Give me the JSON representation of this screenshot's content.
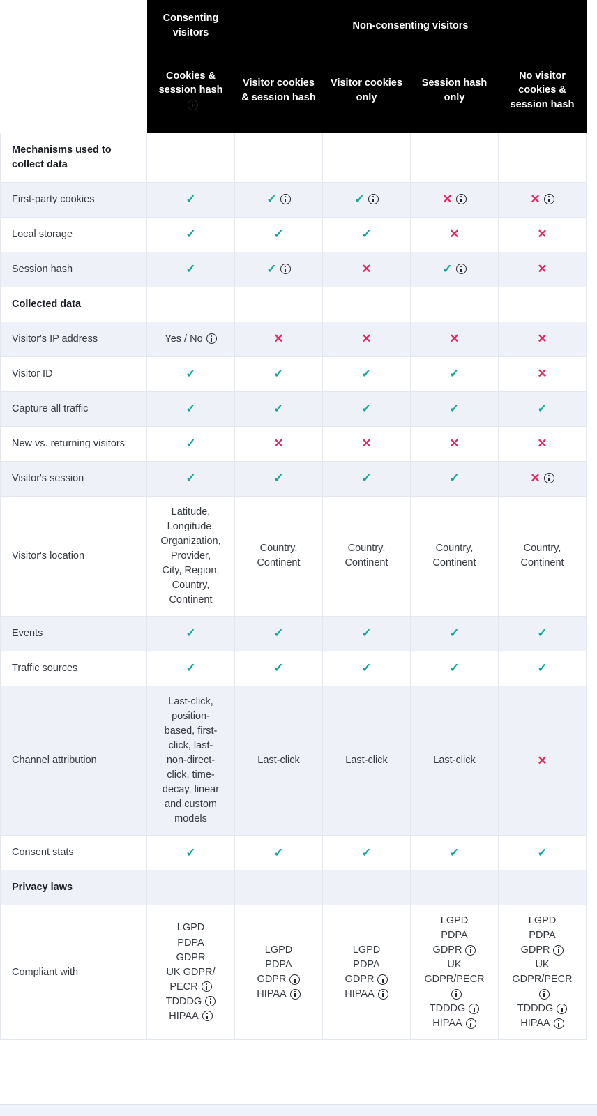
{
  "header": {
    "corner_blank": "",
    "groups": [
      {
        "label": "Consenting visitors",
        "span": 1
      },
      {
        "label": "Non-consenting visitors",
        "span": 4
      }
    ],
    "columns": [
      {
        "label": "Cookies & session hash",
        "info": true
      },
      {
        "label": "Visitor cookies & session hash",
        "info": false
      },
      {
        "label": "Visitor cookies only",
        "info": false
      },
      {
        "label": "Session hash only",
        "info": false
      },
      {
        "label": "No visitor cookies & session hash",
        "info": false
      }
    ]
  },
  "colors": {
    "check": "#0fa896",
    "cross": "#e1295f",
    "header_bg": "#000000",
    "shade_row": "#eef1f7",
    "border": "#e3e8ef",
    "text": "#343a40"
  },
  "rows": [
    {
      "feature": "Mechanisms used to collect data",
      "section": true,
      "shade": false,
      "cells": [
        {
          "type": "empty"
        },
        {
          "type": "empty"
        },
        {
          "type": "empty"
        },
        {
          "type": "empty"
        },
        {
          "type": "empty"
        }
      ]
    },
    {
      "feature": "First-party cookies",
      "section": false,
      "shade": true,
      "cells": [
        {
          "type": "check",
          "info": false
        },
        {
          "type": "check",
          "info": true
        },
        {
          "type": "check",
          "info": true
        },
        {
          "type": "cross",
          "info": true
        },
        {
          "type": "cross",
          "info": true
        }
      ]
    },
    {
      "feature": "Local storage",
      "section": false,
      "shade": false,
      "cells": [
        {
          "type": "check",
          "info": false
        },
        {
          "type": "check",
          "info": false
        },
        {
          "type": "check",
          "info": false
        },
        {
          "type": "cross",
          "info": false
        },
        {
          "type": "cross",
          "info": false
        }
      ]
    },
    {
      "feature": "Session hash",
      "section": false,
      "shade": true,
      "cells": [
        {
          "type": "check",
          "info": false
        },
        {
          "type": "check",
          "info": true
        },
        {
          "type": "cross",
          "info": false
        },
        {
          "type": "check",
          "info": true
        },
        {
          "type": "cross",
          "info": false
        }
      ]
    },
    {
      "feature": "Collected data",
      "section": true,
      "shade": false,
      "cells": [
        {
          "type": "empty"
        },
        {
          "type": "empty"
        },
        {
          "type": "empty"
        },
        {
          "type": "empty"
        },
        {
          "type": "empty"
        }
      ]
    },
    {
      "feature": "Visitor's IP address",
      "section": false,
      "shade": true,
      "cells": [
        {
          "type": "text",
          "text": "Yes / No",
          "info": true
        },
        {
          "type": "cross",
          "info": false
        },
        {
          "type": "cross",
          "info": false
        },
        {
          "type": "cross",
          "info": false
        },
        {
          "type": "cross",
          "info": false
        }
      ]
    },
    {
      "feature": "Visitor ID",
      "section": false,
      "shade": false,
      "cells": [
        {
          "type": "check",
          "info": false
        },
        {
          "type": "check",
          "info": false
        },
        {
          "type": "check",
          "info": false
        },
        {
          "type": "check",
          "info": false
        },
        {
          "type": "cross",
          "info": false
        }
      ]
    },
    {
      "feature": "Capture all traffic",
      "section": false,
      "shade": true,
      "cells": [
        {
          "type": "check",
          "info": false
        },
        {
          "type": "check",
          "info": false
        },
        {
          "type": "check",
          "info": false
        },
        {
          "type": "check",
          "info": false
        },
        {
          "type": "check",
          "info": false
        }
      ]
    },
    {
      "feature": "New vs. returning visitors",
      "section": false,
      "shade": false,
      "cells": [
        {
          "type": "check",
          "info": false
        },
        {
          "type": "cross",
          "info": false
        },
        {
          "type": "cross",
          "info": false
        },
        {
          "type": "cross",
          "info": false
        },
        {
          "type": "cross",
          "info": false
        }
      ]
    },
    {
      "feature": "Visitor's session",
      "section": false,
      "shade": true,
      "cells": [
        {
          "type": "check",
          "info": false
        },
        {
          "type": "check",
          "info": false
        },
        {
          "type": "check",
          "info": false
        },
        {
          "type": "check",
          "info": false
        },
        {
          "type": "cross",
          "info": true
        }
      ]
    },
    {
      "feature": "Visitor's location",
      "section": false,
      "shade": false,
      "cells": [
        {
          "type": "lines",
          "lines": [
            "Latitude,",
            "Longitude,",
            "Organization,",
            "Provider,",
            "City, Region,",
            "Country,",
            "Continent"
          ],
          "info": false
        },
        {
          "type": "lines",
          "lines": [
            "Country,",
            "Continent"
          ],
          "info": false
        },
        {
          "type": "lines",
          "lines": [
            "Country,",
            "Continent"
          ],
          "info": false
        },
        {
          "type": "lines",
          "lines": [
            "Country,",
            "Continent"
          ],
          "info": false
        },
        {
          "type": "lines",
          "lines": [
            "Country,",
            "Continent"
          ],
          "info": false
        }
      ]
    },
    {
      "feature": "Events",
      "section": false,
      "shade": true,
      "cells": [
        {
          "type": "check",
          "info": false
        },
        {
          "type": "check",
          "info": false
        },
        {
          "type": "check",
          "info": false
        },
        {
          "type": "check",
          "info": false
        },
        {
          "type": "check",
          "info": false
        }
      ]
    },
    {
      "feature": "Traffic sources",
      "section": false,
      "shade": false,
      "cells": [
        {
          "type": "check",
          "info": false
        },
        {
          "type": "check",
          "info": false
        },
        {
          "type": "check",
          "info": false
        },
        {
          "type": "check",
          "info": false
        },
        {
          "type": "check",
          "info": false
        }
      ]
    },
    {
      "feature": "Channel attribution",
      "section": false,
      "shade": true,
      "cells": [
        {
          "type": "lines",
          "lines": [
            "Last-click,",
            "position-",
            "based, first-",
            "click, last-",
            "non-direct-",
            "click, time-",
            "decay, linear",
            "and custom",
            "models"
          ],
          "info": false
        },
        {
          "type": "text",
          "text": "Last-click",
          "info": false
        },
        {
          "type": "text",
          "text": "Last-click",
          "info": false
        },
        {
          "type": "text",
          "text": "Last-click",
          "info": false
        },
        {
          "type": "cross",
          "info": false
        }
      ]
    },
    {
      "feature": "Consent stats",
      "section": false,
      "shade": false,
      "cells": [
        {
          "type": "check",
          "info": false
        },
        {
          "type": "check",
          "info": false
        },
        {
          "type": "check",
          "info": false
        },
        {
          "type": "check",
          "info": false
        },
        {
          "type": "check",
          "info": false
        }
      ]
    },
    {
      "feature": "Privacy laws",
      "section": true,
      "shade": true,
      "cells": [
        {
          "type": "empty"
        },
        {
          "type": "empty"
        },
        {
          "type": "empty"
        },
        {
          "type": "empty"
        },
        {
          "type": "empty"
        }
      ]
    },
    {
      "feature": "Compliant with",
      "section": false,
      "shade": false,
      "cells": [
        {
          "type": "infolines",
          "lines": [
            {
              "text": "LGPD",
              "info": false
            },
            {
              "text": "PDPA",
              "info": false
            },
            {
              "text": "GDPR",
              "info": false
            },
            {
              "text": "UK GDPR/",
              "info": false
            },
            {
              "text": "PECR",
              "info": true
            },
            {
              "text": "TDDDG",
              "info": true
            },
            {
              "text": "HIPAA",
              "info": true
            }
          ]
        },
        {
          "type": "infolines",
          "lines": [
            {
              "text": "LGPD",
              "info": false
            },
            {
              "text": "PDPA",
              "info": false
            },
            {
              "text": "GDPR",
              "info": true
            },
            {
              "text": "HIPAA",
              "info": true
            }
          ]
        },
        {
          "type": "infolines",
          "lines": [
            {
              "text": "LGPD",
              "info": false
            },
            {
              "text": "PDPA",
              "info": false
            },
            {
              "text": "GDPR",
              "info": true
            },
            {
              "text": "HIPAA",
              "info": true
            }
          ]
        },
        {
          "type": "infolines",
          "lines": [
            {
              "text": "LGPD",
              "info": false
            },
            {
              "text": "PDPA",
              "info": false
            },
            {
              "text": "GDPR",
              "info": true
            },
            {
              "text": "UK",
              "info": false
            },
            {
              "text": "GDPR/PECR",
              "info": false
            },
            {
              "text": "",
              "info": true
            },
            {
              "text": "TDDDG",
              "info": true
            },
            {
              "text": "HIPAA",
              "info": true
            }
          ]
        },
        {
          "type": "infolines",
          "lines": [
            {
              "text": "LGPD",
              "info": false
            },
            {
              "text": "PDPA",
              "info": false
            },
            {
              "text": "GDPR",
              "info": true
            },
            {
              "text": "UK",
              "info": false
            },
            {
              "text": "GDPR/PECR",
              "info": false
            },
            {
              "text": "",
              "info": true
            },
            {
              "text": "TDDDG",
              "info": true
            },
            {
              "text": "HIPAA",
              "info": true
            }
          ]
        }
      ]
    }
  ],
  "glyphs": {
    "check": "✓",
    "cross": "✕",
    "info_icon": "info-icon"
  }
}
